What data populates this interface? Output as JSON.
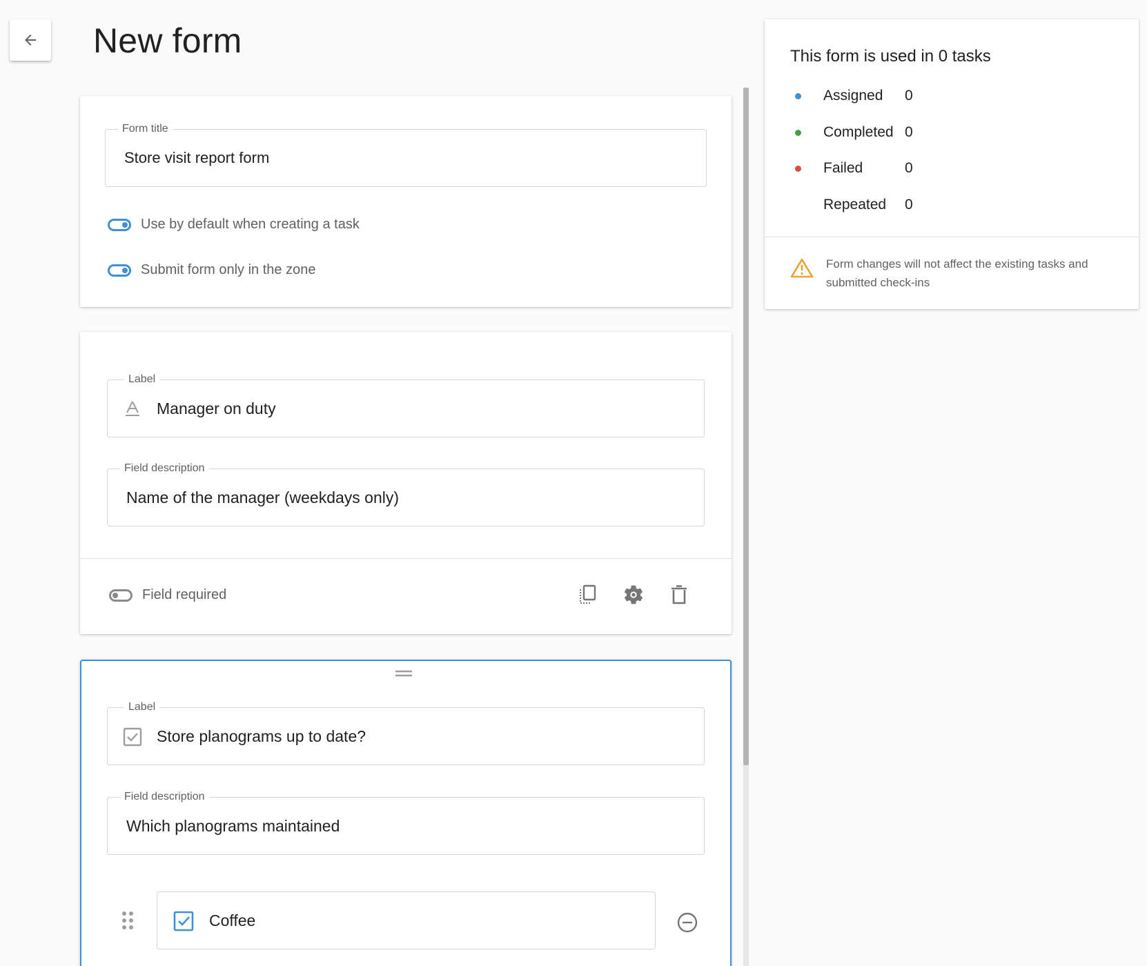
{
  "page": {
    "title": "New form"
  },
  "form_card": {
    "title_label": "Form title",
    "title_value": "Store visit report form",
    "toggle_default_label": "Use by default when creating a task",
    "toggle_zone_label": "Submit form only in the zone"
  },
  "field_text": {
    "label_caption": "Label",
    "label_value": "Manager on duty",
    "desc_caption": "Field description",
    "desc_value": "Name of the manager (weekdays only)",
    "required_label": "Field required"
  },
  "field_checkbox": {
    "label_caption": "Label",
    "label_value": "Store planograms up to date?",
    "desc_caption": "Field description",
    "desc_value": "Which planograms maintained",
    "options": [
      {
        "label": "Coffee"
      }
    ]
  },
  "stats": {
    "title": "This form is used in 0 tasks",
    "rows": [
      {
        "name": "Assigned",
        "value": "0",
        "color": "#3d8fd6"
      },
      {
        "name": "Completed",
        "value": "0",
        "color": "#43a047"
      },
      {
        "name": "Failed",
        "value": "0",
        "color": "#e04b3a"
      },
      {
        "name": "Repeated",
        "value": "0",
        "color": ""
      }
    ],
    "warning": "Form changes will not affect the existing tasks and submitted check-ins"
  },
  "colors": {
    "accent": "#3d8fd6",
    "warning": "#f0a030"
  }
}
